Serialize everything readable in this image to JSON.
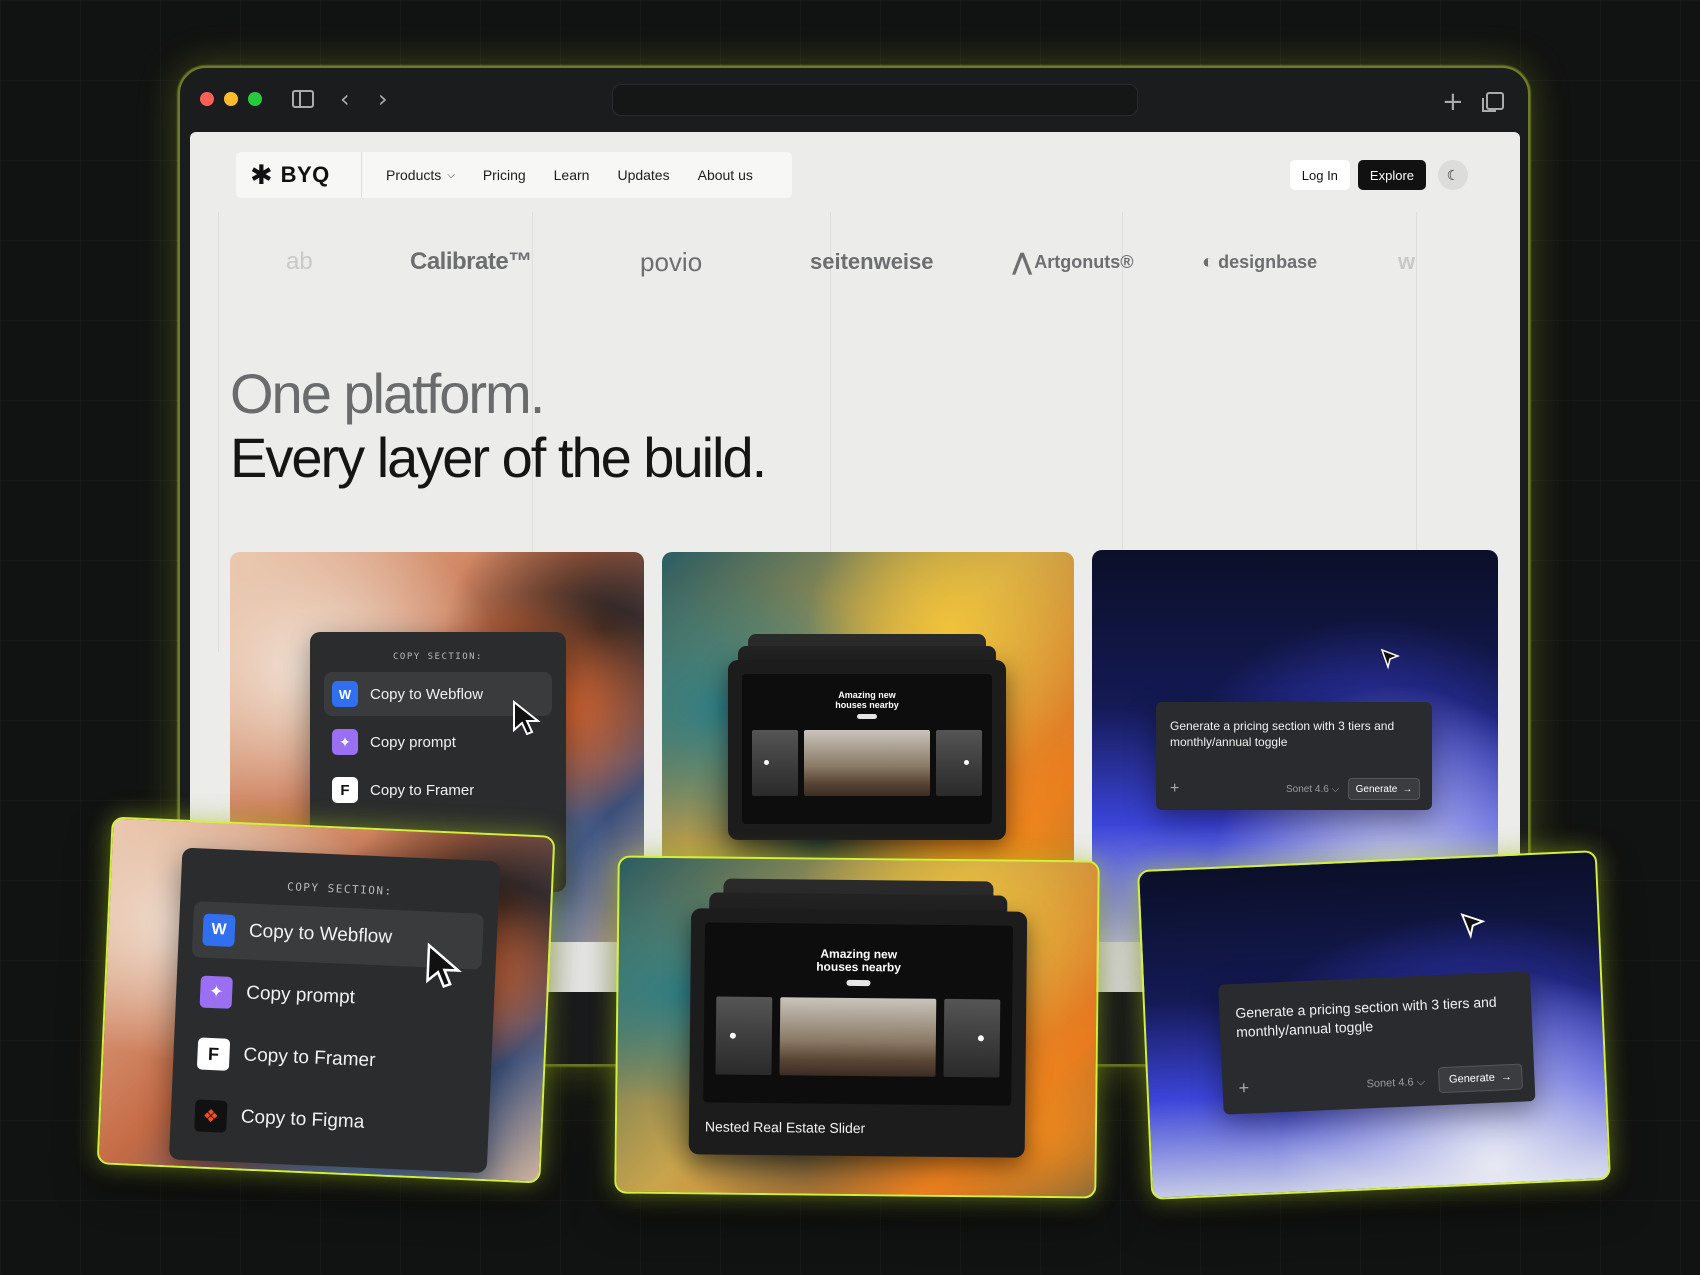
{
  "browser": {
    "new_tab_icon": "plus-icon",
    "tabs_icon": "tabs-icon"
  },
  "nav": {
    "logo_mark": "✱",
    "logo_text": "BYQ",
    "items": [
      {
        "label": "Products",
        "has_dropdown": true
      },
      {
        "label": "Pricing"
      },
      {
        "label": "Learn"
      },
      {
        "label": "Updates"
      },
      {
        "label": "About us"
      }
    ],
    "login": "Log In",
    "explore": "Explore",
    "theme_icon": "moon-icon"
  },
  "brands": [
    "ab",
    "Calibrate™",
    "povio",
    "seitenweise",
    "Artgonuts®",
    "designbase",
    "w"
  ],
  "hero": {
    "line1": "One platform.",
    "line2": "Every layer of the build."
  },
  "copy_card": {
    "heading": "COPY SECTION:",
    "items": [
      {
        "label": "Copy to Webflow",
        "icon": "webflow-icon",
        "glyph": "W"
      },
      {
        "label": "Copy prompt",
        "icon": "sparkle-icon",
        "glyph": "✦"
      },
      {
        "label": "Copy to Framer",
        "icon": "framer-icon",
        "glyph": "F"
      },
      {
        "label": "Copy to Figma",
        "icon": "figma-icon",
        "glyph": "❖"
      }
    ]
  },
  "slider_card": {
    "title_line1": "Amazing new",
    "title_line2": "houses nearby",
    "caption": "Nested Real Estate Slider"
  },
  "prompt_card": {
    "text": "Generate a pricing section with 3 tiers and monthly/annual toggle",
    "plus": "+",
    "model": "Sonet 4.6",
    "generate": "Generate"
  },
  "colors": {
    "accent_glow": "#d4ef3a",
    "page_bg": "#ececeb",
    "webflow_blue": "#2f6ff0",
    "prompt_purple": "#9b6ff2"
  }
}
